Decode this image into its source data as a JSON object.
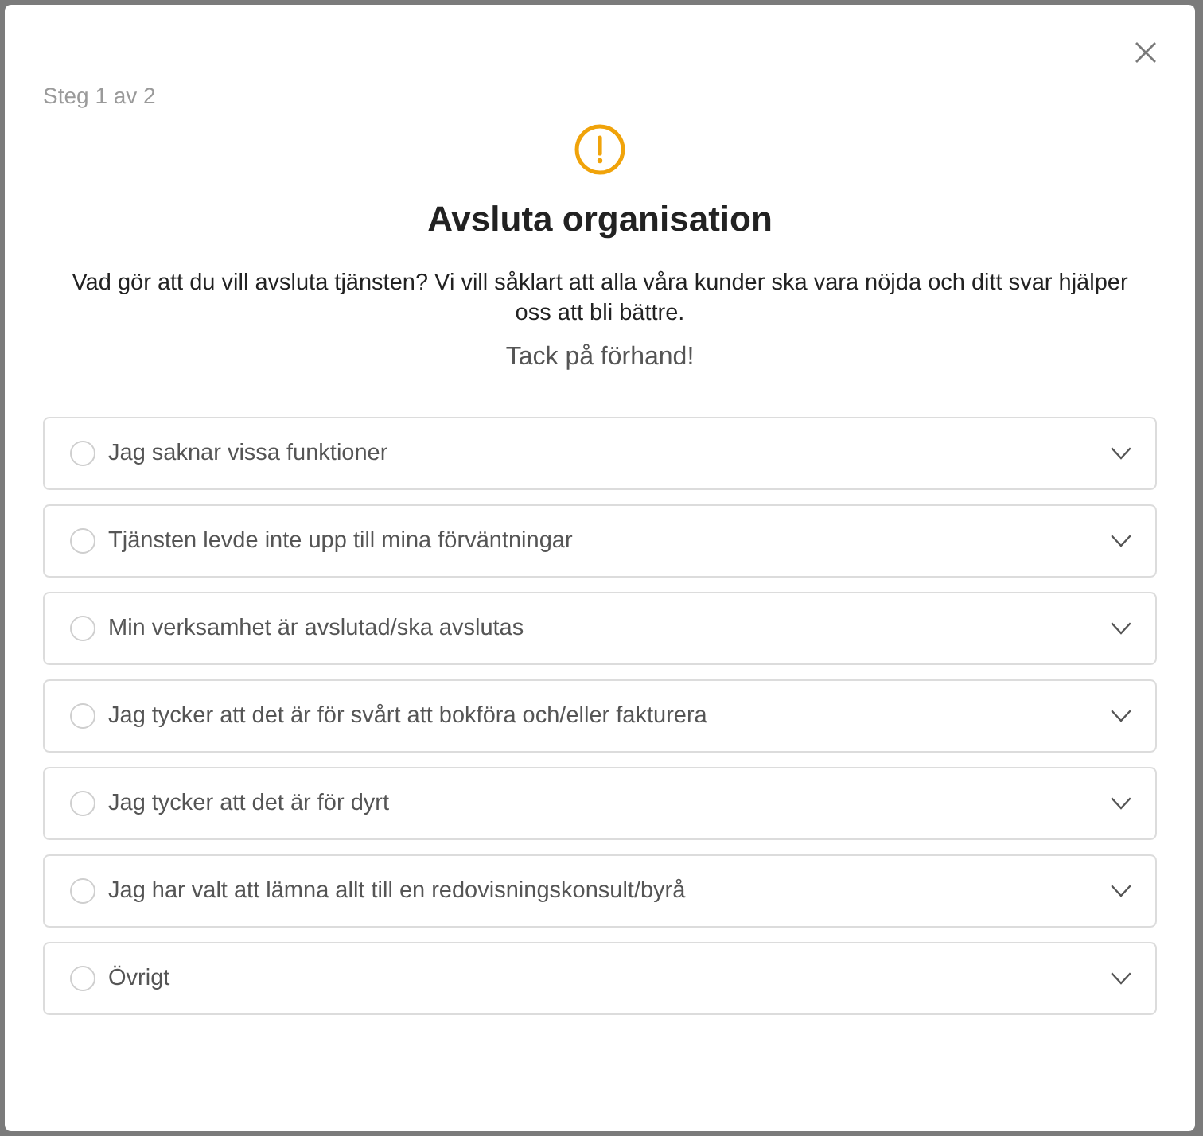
{
  "dialog": {
    "step": "Steg 1 av 2",
    "title": "Avsluta organisation",
    "description": "Vad gör att du vill avsluta tjänsten? Vi vill såklart att alla våra kunder ska vara nöjda och ditt svar hjälper oss att bli bättre.",
    "note": "Tack på förhand!"
  },
  "options": [
    {
      "label": "Jag saknar vissa funktioner",
      "selected": false,
      "expanded": false
    },
    {
      "label": "Tjänsten levde inte upp till mina förväntningar",
      "selected": false,
      "expanded": false
    },
    {
      "label": "Min verksamhet är avslutad/ska avslutas",
      "selected": false,
      "expanded": false
    },
    {
      "label": "Jag tycker att det är för svårt att bokföra och/eller fakturera",
      "selected": false,
      "expanded": false
    },
    {
      "label": "Jag tycker att det är för dyrt",
      "selected": false,
      "expanded": false
    },
    {
      "label": "Jag har valt att lämna allt till en redovisningskonsult/byrå",
      "selected": false,
      "expanded": false
    },
    {
      "label": "Övrigt",
      "selected": false,
      "expanded": false
    }
  ]
}
